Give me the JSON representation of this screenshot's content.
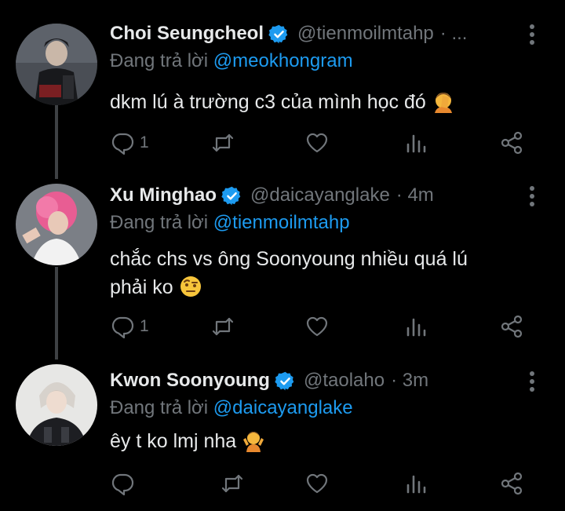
{
  "tweets": [
    {
      "name": "Choi Seungcheol",
      "handle": "@tienmoilmtahp",
      "meta": "· ...",
      "reply_prefix": "Đang trả lời",
      "reply_to": "@meokhongram",
      "text": "dkm lú à trường c3 của mình học đó",
      "emoji": "person-facepalming",
      "reply_count": "1"
    },
    {
      "name": "Xu Minghao",
      "handle": "@daicayanglake",
      "meta": "· 4m",
      "reply_prefix": "Đang trả lời",
      "reply_to": "@tienmoilmtahp",
      "text_line1": "chắc chs vs ông Soonyoung nhiều quá lú",
      "text_line2": "phải ko",
      "emoji": "face-with-raised-eyebrow",
      "reply_count": "1"
    },
    {
      "name": "Kwon Soonyoung",
      "handle": "@taolaho",
      "meta": "· 3m",
      "reply_prefix": "Đang trả lời",
      "reply_to": "@daicayanglake",
      "text": "êy t ko lmj nha",
      "emoji": "person-shrugging",
      "reply_count": ""
    }
  ],
  "colors": {
    "background": "#000000",
    "text": "#e7e9ea",
    "muted": "#71767b",
    "accent": "#1d9bf0",
    "thread_line": "#3e4144"
  }
}
